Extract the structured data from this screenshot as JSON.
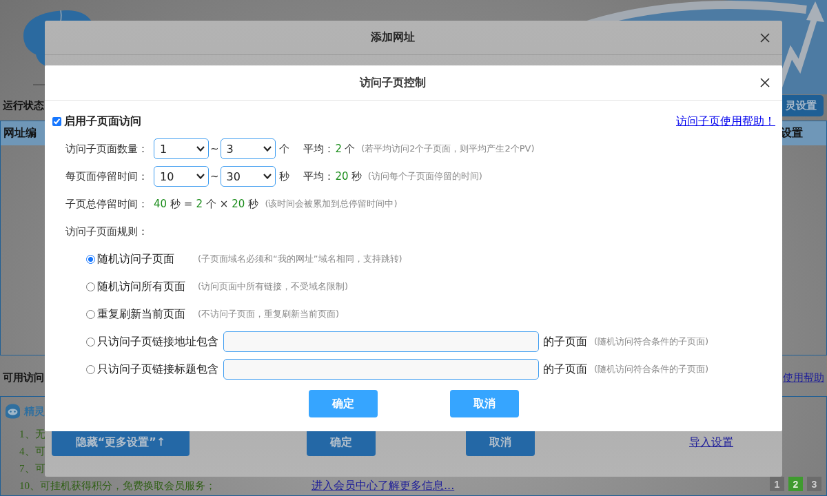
{
  "background_page": {
    "status_title": "运行状态",
    "settings_button": "灵设置",
    "table": {
      "columns": [
        "网址编",
        "设置"
      ]
    },
    "available_title": "可用访问",
    "help_link": "使用帮助",
    "tips": {
      "title": "精灵",
      "items": [
        "1、无",
        "4、可",
        "7、可",
        "10、可挂机获得积分，免费换取会员服务；"
      ],
      "member_link": "进入会员中心了解更多信息..."
    },
    "pagination": [
      {
        "label": "1",
        "selected": false
      },
      {
        "label": "2",
        "selected": true
      },
      {
        "label": "3",
        "selected": false
      }
    ]
  },
  "outer_dialog": {
    "title": "添加网址",
    "buttons": [
      "隐藏“更多设置”↑",
      "确定",
      "取消"
    ],
    "import_link": "导入设置"
  },
  "dialog": {
    "title": "访问子页控制",
    "enable": {
      "label": "启用子页面访问",
      "checked": true
    },
    "help_link": "访问子页使用帮助！",
    "settings": [
      {
        "label": "访问子页面数量：",
        "min": "1",
        "separator": "~",
        "max": "3",
        "unit": "个",
        "average": {
          "label": "平均：",
          "value": "2",
          "unit": "个"
        },
        "hint": "(若平均访问2个子页面，则平均产生2个PV)"
      },
      {
        "label": "每页面停留时间：",
        "min": "10",
        "separator": "~",
        "max": "30",
        "unit": "秒",
        "average": {
          "label": "平均：",
          "value": "20",
          "unit": "秒"
        },
        "hint": "(访问每个子页面停留的时间)"
      }
    ],
    "total": {
      "label": "子页总停留时间：",
      "formula": [
        {
          "kind": "value",
          "text": "40"
        },
        {
          "kind": "text",
          "text": "秒 ="
        },
        {
          "kind": "value",
          "text": "2"
        },
        {
          "kind": "text",
          "text": "个 ×"
        },
        {
          "kind": "value",
          "text": "20"
        },
        {
          "kind": "text",
          "text": "秒"
        }
      ],
      "hint": "(该时间会被累加到总停留时间中)"
    },
    "rules_label": "访问子页面规则：",
    "rules": [
      {
        "kind": "plain",
        "label": "随机访问子页面",
        "selected": true,
        "hint": "(子页面域名必须和“我的网址”域名相同，支持跳转)"
      },
      {
        "kind": "plain",
        "label": "随机访问所有页面",
        "selected": false,
        "hint": "(访问页面中所有链接，不受域名限制)"
      },
      {
        "kind": "plain",
        "label": "重复刷新当前页面",
        "selected": false,
        "hint": "(不访问子页面，重复刷新当前页面)"
      },
      {
        "kind": "input",
        "label": "只访问子页链接地址包含",
        "selected": false,
        "suffix": "的子页面",
        "hint": "(随机访问符合条件的子页面)"
      },
      {
        "kind": "input",
        "label": "只访问子页链接标题包含",
        "selected": false,
        "suffix": "的子页面",
        "hint": "(随机访问符合条件的子页面)"
      }
    ],
    "buttons": [
      "确定",
      "取消"
    ]
  }
}
